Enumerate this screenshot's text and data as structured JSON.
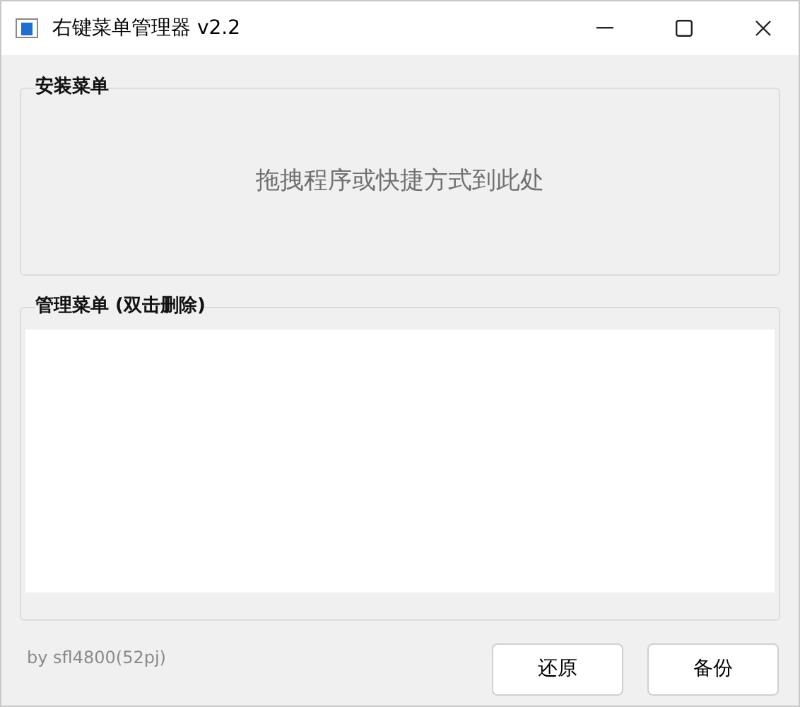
{
  "window": {
    "title": "右键菜单管理器 v2.2"
  },
  "install_group": {
    "label": "安装菜单",
    "drop_hint": "拖拽程序或快捷方式到此处"
  },
  "manage_group": {
    "label": "管理菜单 (双击删除)"
  },
  "footer": {
    "credit": "by sfl4800(52pj)"
  },
  "buttons": [
    "还原",
    "备份"
  ]
}
